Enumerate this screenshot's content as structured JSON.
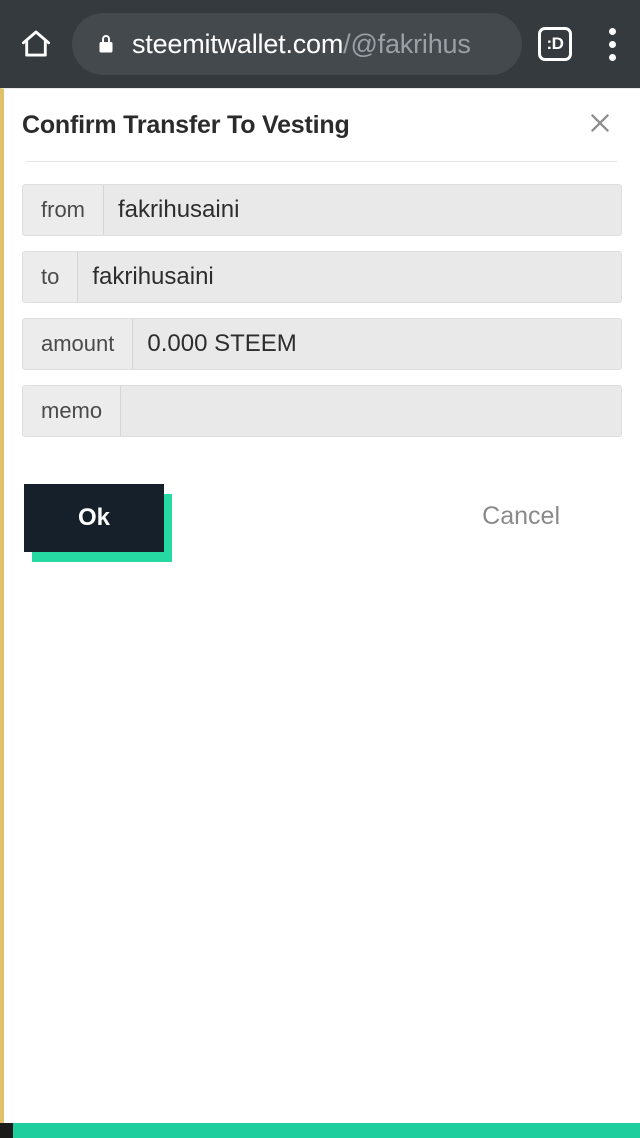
{
  "browser": {
    "home_icon": "home-icon",
    "lock_icon": "lock-icon",
    "url_domain": "steemitwallet.com",
    "url_path": "/@fakrihus",
    "tab_count_label": ":D",
    "menu_icon": "three-dot-menu-icon",
    "toolbar_bg": "#353a3e",
    "omnibox_bg": "#44494d"
  },
  "dialog": {
    "title": "Confirm Transfer To Vesting",
    "close_icon": "close-icon",
    "fields": [
      {
        "label": "from",
        "value": "fakrihusaini"
      },
      {
        "label": "to",
        "value": "fakrihusaini"
      },
      {
        "label": "amount",
        "value": "0.000 STEEM"
      },
      {
        "label": "memo",
        "value": ""
      }
    ],
    "ok_label": "Ok",
    "cancel_label": "Cancel",
    "ok_bg": "#15202b",
    "ok_shadow": "#26d9a2",
    "accent_border": "#e0c068"
  },
  "bottom": {
    "bar_color": "#1ecf9d"
  }
}
